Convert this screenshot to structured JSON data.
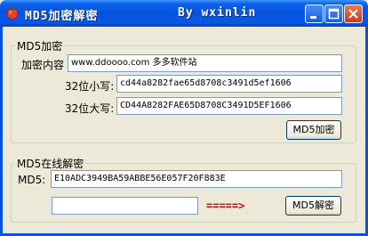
{
  "window": {
    "title": "MD5加密解密",
    "author": "By wxinlin",
    "buttons": [
      "minimize",
      "maximize",
      "close"
    ]
  },
  "encrypt_group": {
    "legend": "MD5加密",
    "content_label": "加密内容",
    "content_value": "www.ddoooo.com 多多软件站",
    "lower_label": "32位小写:",
    "lower_value": "cd44a8282fae65d8708c3491d5ef1606",
    "upper_label": "32位大写:",
    "upper_value": "CD44A8282FAE65D8708C3491D5EF1606",
    "encrypt_button": "MD5加密"
  },
  "decrypt_group": {
    "legend": "MD5在线解密",
    "md5_label": "MD5:",
    "md5_value": "E10ADC3949BA59ABBE56E057F20F883E",
    "result_value": "",
    "arrow": "=====>",
    "decrypt_button": "MD5解密"
  },
  "colors": {
    "titlebar": "#0553e0",
    "face": "#ece9d8",
    "arrow": "#e00000"
  }
}
